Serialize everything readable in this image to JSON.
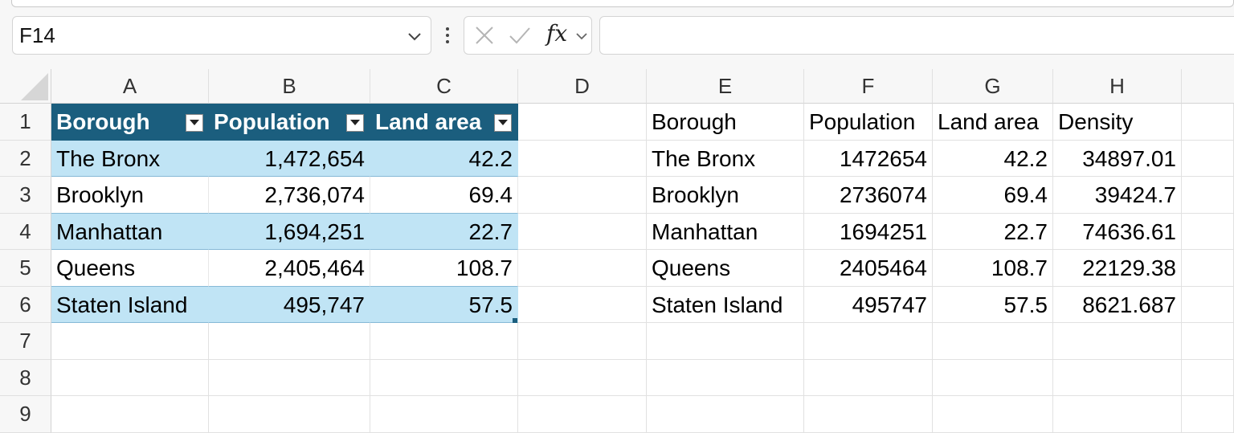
{
  "formula_bar": {
    "name_box": "F14",
    "fx_label": "fx",
    "formula": ""
  },
  "columns": [
    "A",
    "B",
    "C",
    "D",
    "E",
    "F",
    "G",
    "H"
  ],
  "rows": [
    "1",
    "2",
    "3",
    "4",
    "5",
    "6",
    "7",
    "8",
    "9"
  ],
  "table_left": {
    "headers": [
      "Borough",
      "Population",
      "Land area"
    ],
    "rows": [
      [
        "The Bronx",
        "1,472,654",
        "42.2"
      ],
      [
        "Brooklyn",
        "2,736,074",
        "69.4"
      ],
      [
        "Manhattan",
        "1,694,251",
        "22.7"
      ],
      [
        "Queens",
        "2,405,464",
        "108.7"
      ],
      [
        "Staten Island",
        "495,747",
        "57.5"
      ]
    ]
  },
  "table_right": {
    "headers": [
      "Borough",
      "Population",
      "Land area",
      "Density"
    ],
    "rows": [
      [
        "The Bronx",
        "1472654",
        "42.2",
        "34897.01"
      ],
      [
        "Brooklyn",
        "2736074",
        "69.4",
        "39424.7"
      ],
      [
        "Manhattan",
        "1694251",
        "22.7",
        "74636.61"
      ],
      [
        "Queens",
        "2405464",
        "108.7",
        "22129.38"
      ],
      [
        "Staten Island",
        "495747",
        "57.5",
        "8621.687"
      ]
    ]
  },
  "colors": {
    "table_header": "#1b5e7e",
    "table_band": "#c0e4f5"
  }
}
